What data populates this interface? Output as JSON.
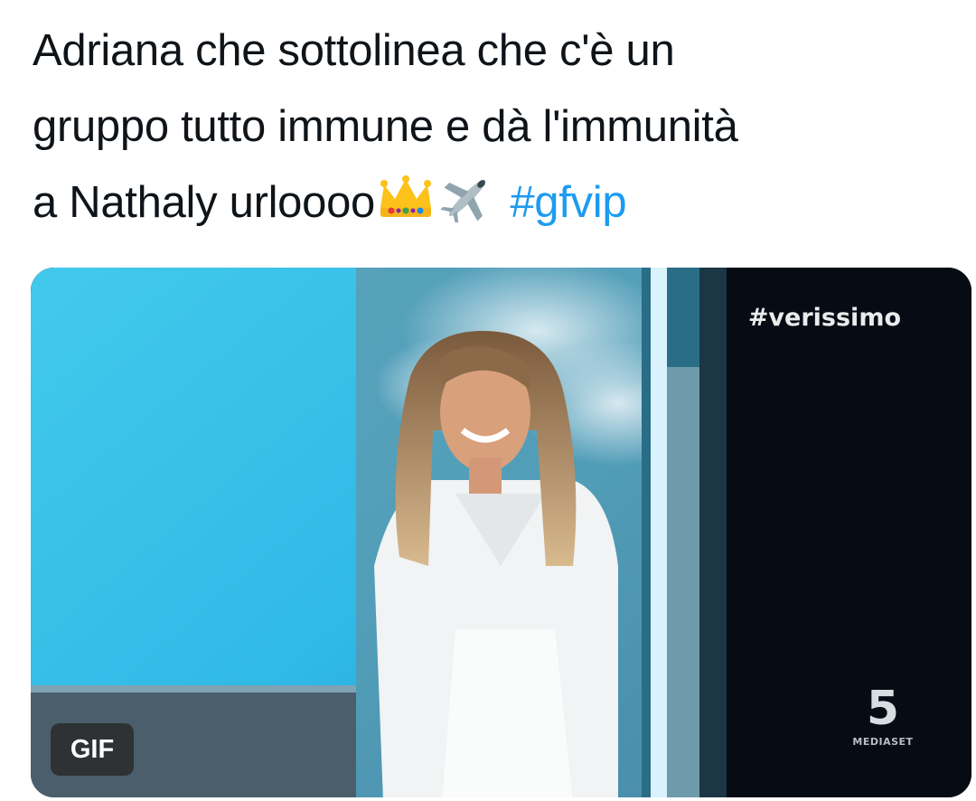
{
  "tweet": {
    "text_lines": [
      "Adriana che sottolinea che c'è un",
      "gruppo tutto immune e dà l'immunità",
      "a Nathaly urloooo"
    ],
    "emoji_1": "👑",
    "emoji_2": "✈️",
    "hashtag": "#gfvip",
    "hashtag_color": "#1d9bf0"
  },
  "media": {
    "type": "gif",
    "overlay_hashtag": "#verissimo",
    "gif_badge_label": "GIF",
    "channel_logo_number": "5",
    "channel_logo_brand": "MEDIASET"
  }
}
